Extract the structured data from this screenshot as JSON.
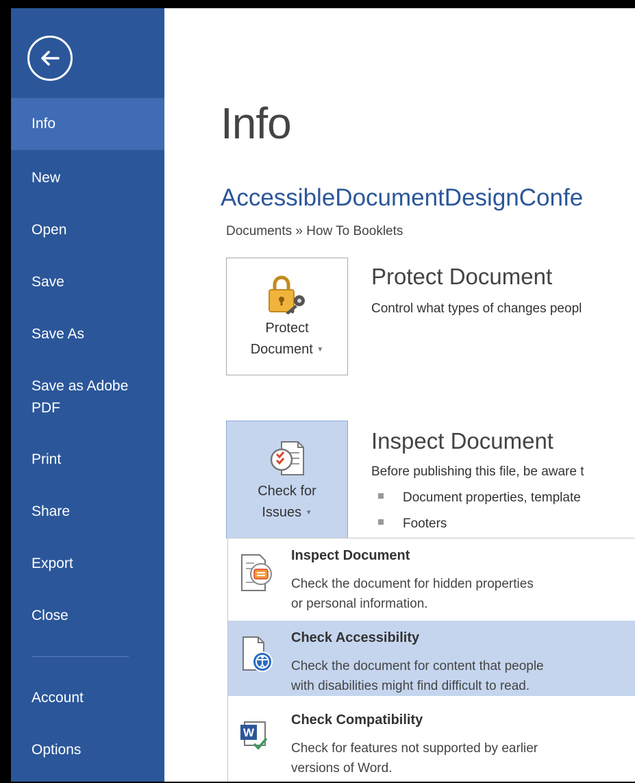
{
  "sidebar": {
    "items": [
      {
        "label": "Info"
      },
      {
        "label": "New"
      },
      {
        "label": "Open"
      },
      {
        "label": "Save"
      },
      {
        "label": "Save As"
      },
      {
        "label": "Save as Adobe PDF"
      },
      {
        "label": "Print"
      },
      {
        "label": "Share"
      },
      {
        "label": "Export"
      },
      {
        "label": "Close"
      },
      {
        "label": "Account"
      },
      {
        "label": "Options"
      }
    ],
    "selected": "Info"
  },
  "main": {
    "title": "Info",
    "doc_name": "AccessibleDocumentDesignConfe",
    "doc_path": "Documents » How To Booklets",
    "protect": {
      "button_line1": "Protect",
      "button_line2": "Document",
      "heading": "Protect Document",
      "desc": "Control what types of changes peopl"
    },
    "inspect": {
      "button_line1": "Check for",
      "button_line2": "Issues",
      "heading": "Inspect Document",
      "desc": "Before publishing this file, be aware t",
      "bullets": [
        "Document properties, template",
        "Footers"
      ]
    }
  },
  "menu": {
    "items": [
      {
        "title": "Inspect Document",
        "desc1": "Check the document for hidden properties",
        "desc2": "or personal information."
      },
      {
        "title": "Check Accessibility",
        "desc1": "Check the document for content that people",
        "desc2": "with disabilities might find difficult to read."
      },
      {
        "title": "Check Compatibility",
        "desc1": "Check for features not supported by earlier",
        "desc2": "versions of Word."
      }
    ]
  },
  "colors": {
    "sidebar": "#2b579a",
    "sidebar_selected": "#3f6cb4",
    "highlight": "#c5d5ee",
    "link_blue": "#2b579a"
  }
}
